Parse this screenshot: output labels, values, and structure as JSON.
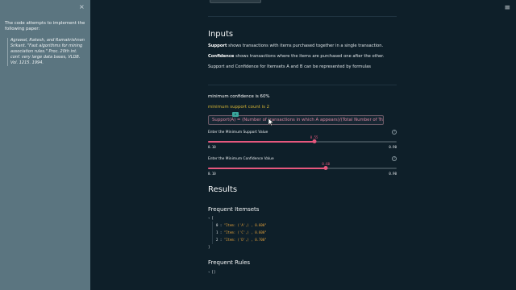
{
  "sidebar": {
    "close_icon": "×",
    "intro": "The code attempts to implement the following paper:",
    "citation": "Agrawal, Rakesh, and Ramakrishnan Srikant. \"Fast algorithms for mining association rules.\" Proc. 20th int. conf. very large data bases, VLDB. Vol. 1215. 1994."
  },
  "header": {
    "menu_icon": "≡"
  },
  "inputs": {
    "title": "Inputs",
    "support_term": "Support",
    "support_desc": " shows transactions with items purchased together in a single transaction.",
    "confidence_term": "Confidence",
    "confidence_desc": " shows transactions where the items are purchased one after the other.",
    "formula_note": "Support and Confidence for Itemsets A and B can be represented by formulas"
  },
  "status": {
    "min_confidence": "minimum confidence is 60%",
    "min_support": "minimum support count is 2"
  },
  "formula": {
    "text": "Support(A) = (Number of transactions in which A appears)/(Total Number of Transactions)",
    "tag": "A"
  },
  "sliders": [
    {
      "label": "Enter the Minimum Support Value",
      "value": "0.55",
      "fraction": 0.5625,
      "min": "0.10",
      "max": "0.90"
    },
    {
      "label": "Enter the Minimum Confidence Value",
      "value": "0.60",
      "fraction": 0.625,
      "min": "0.10",
      "max": "0.90"
    }
  ],
  "results": {
    "title": "Results",
    "frequent_itemsets_title": "Frequent Itemsets",
    "itemsets_open": "[",
    "itemsets": [
      {
        "index": "0",
        "value": "\"Item: ('A',) , 0.600\""
      },
      {
        "index": "1",
        "value": "\"Item: ('C',) , 0.600\""
      },
      {
        "index": "2",
        "value": "\"Item: ('D',) , 0.700\""
      }
    ],
    "itemsets_close": "]",
    "frequent_rules_title": "Frequent Rules",
    "rules_value": "[]"
  },
  "colors": {
    "accent": "#e6577d",
    "warning": "#d6b535",
    "sidebar": "#5b7580",
    "background": "#0e1f29"
  }
}
